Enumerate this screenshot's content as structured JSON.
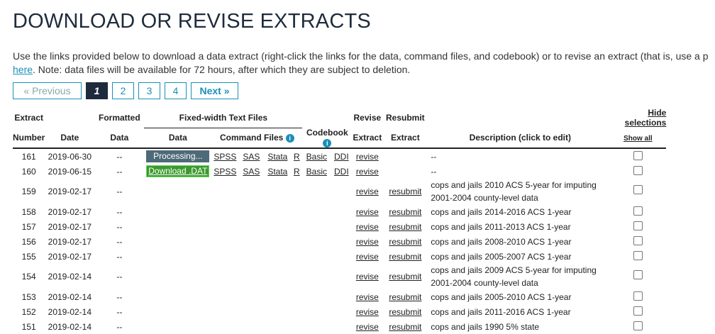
{
  "page": {
    "title": "DOWNLOAD OR REVISE EXTRACTS",
    "intro_line1": "Use the links provided below to download a data extract (right-click the links for the data, command files, and codebook) or to revise an extract (that is, use a p",
    "intro_link": "here",
    "intro_line2": ". Note: data files will be available for 72 hours, after which they are subject to deletion."
  },
  "pagination": {
    "prev": "« Previous",
    "current": "1",
    "pages": [
      "2",
      "3",
      "4"
    ],
    "next": "Next »"
  },
  "table": {
    "headers": {
      "extract_number": [
        "Extract",
        "Number"
      ],
      "date": "Date",
      "formatted_data": [
        "Formatted",
        "Data"
      ],
      "fixed_width_group": "Fixed-width Text Files",
      "data": "Data",
      "command_files": "Command Files",
      "codebook": "Codebook",
      "revise_extract": [
        "Revise",
        "Extract"
      ],
      "resubmit_extract": [
        "Resubmit",
        "Extract"
      ],
      "description": "Description (click to edit)",
      "hide_selections": "Hide selections",
      "show_all": "Show all"
    },
    "links": {
      "processing": "Processing...",
      "download": "Download .DAT",
      "spss": "SPSS",
      "sas": "SAS",
      "stata": "Stata",
      "r": "R",
      "basic": "Basic",
      "ddi": "DDI",
      "revise": "revise",
      "resubmit": "resubmit"
    },
    "rows": [
      {
        "number": "161",
        "date": "2019-06-30",
        "formatted": "--",
        "status": "processing",
        "description": "--"
      },
      {
        "number": "160",
        "date": "2019-06-15",
        "formatted": "--",
        "status": "download",
        "description": "--"
      },
      {
        "number": "159",
        "date": "2019-02-17",
        "formatted": "--",
        "status": "none",
        "description": "cops and jails 2010 ACS 5-year for imputing 2001-2004 county-level data"
      },
      {
        "number": "158",
        "date": "2019-02-17",
        "formatted": "--",
        "status": "none",
        "description": "cops and jails 2014-2016 ACS 1-year"
      },
      {
        "number": "157",
        "date": "2019-02-17",
        "formatted": "--",
        "status": "none",
        "description": "cops and jails 2011-2013 ACS 1-year"
      },
      {
        "number": "156",
        "date": "2019-02-17",
        "formatted": "--",
        "status": "none",
        "description": "cops and jails 2008-2010 ACS 1-year"
      },
      {
        "number": "155",
        "date": "2019-02-17",
        "formatted": "--",
        "status": "none",
        "description": "cops and jails 2005-2007 ACS 1-year"
      },
      {
        "number": "154",
        "date": "2019-02-14",
        "formatted": "--",
        "status": "none",
        "description": "cops and jails 2009 ACS 5-year for imputing 2001-2004 county-level data"
      },
      {
        "number": "153",
        "date": "2019-02-14",
        "formatted": "--",
        "status": "none",
        "description": "cops and jails 2005-2010 ACS 1-year"
      },
      {
        "number": "152",
        "date": "2019-02-14",
        "formatted": "--",
        "status": "none",
        "description": "cops and jails 2011-2016 ACS 1-year"
      },
      {
        "number": "151",
        "date": "2019-02-14",
        "formatted": "--",
        "status": "none",
        "description": "cops and jails 1990 5% state"
      }
    ]
  },
  "colors": {
    "link": "#1b8fb8",
    "heading": "#1e2b3c",
    "processing_bg": "#4e6a79",
    "download_bg": "#3a9a2e"
  }
}
